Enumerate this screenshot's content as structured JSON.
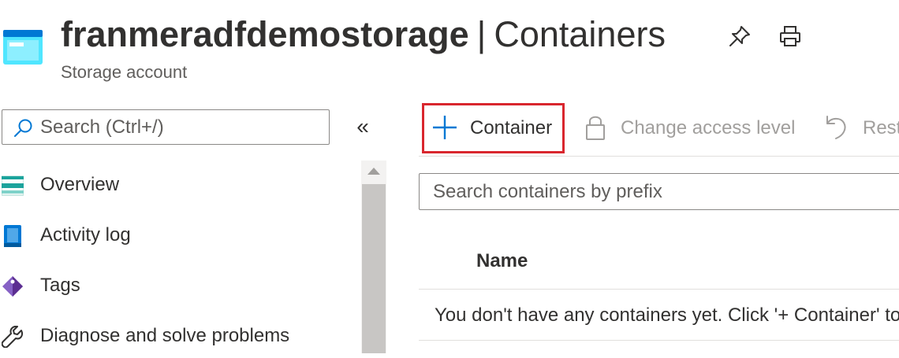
{
  "header": {
    "resource_name": "franmeradfdemostorage",
    "separator": "|",
    "section": "Containers",
    "subtitle": "Storage account",
    "pin_icon": "pin-icon",
    "print_icon": "print-icon",
    "resource_icon": "storage-account-icon"
  },
  "left_nav": {
    "search_placeholder": "Search (Ctrl+/)",
    "collapse_glyph": "«",
    "items": [
      {
        "label": "Overview",
        "icon": "overview-icon"
      },
      {
        "label": "Activity log",
        "icon": "activity-log-icon"
      },
      {
        "label": "Tags",
        "icon": "tag-icon"
      },
      {
        "label": "Diagnose and solve problems",
        "icon": "wrench-icon"
      }
    ]
  },
  "toolbar": {
    "add_container_label": "Container",
    "change_access_label": "Change access level",
    "restore_label": "Restore containers"
  },
  "main": {
    "search_placeholder": "Search containers by prefix",
    "table": {
      "columns": [
        "Name"
      ],
      "empty_message": "You don't have any containers yet. Click '+ Container' to get started."
    }
  },
  "colors": {
    "accent": "#0078d4",
    "highlight_border": "#d9262e",
    "disabled_text": "#a19f9d"
  }
}
